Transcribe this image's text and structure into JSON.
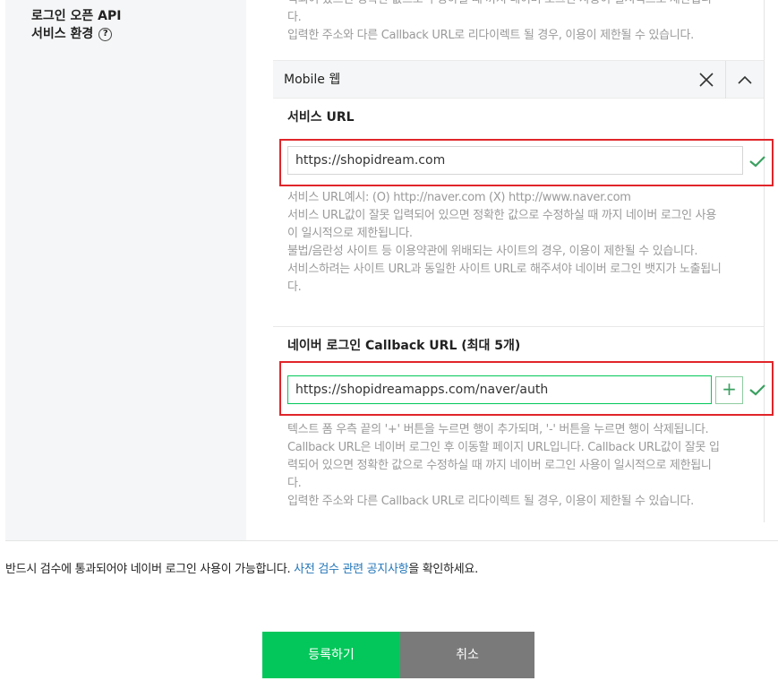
{
  "left": {
    "label_line1": "로그인 오픈 API",
    "label_line2": "서비스 환경",
    "help_glyph": "?"
  },
  "top_help": {
    "line1": "력되어 있으면 정확한 값으로 수정하실 때 까지 네이버 로그인 사용이 일시적으로 제한됩니",
    "line2": "다.",
    "line3": "입력한 주소와 다른 Callback URL로 리다이렉트 될 경우, 이용이 제한될 수 있습니다."
  },
  "section": {
    "title": "Mobile 웹",
    "close_glyph": "✕",
    "collapse_glyph": "︿"
  },
  "service_url": {
    "label": "서비스 URL",
    "value": "https://shopidream.com",
    "help": [
      "서비스 URL예시: (O) http://naver.com (X) http://www.naver.com",
      "서비스 URL값이 잘못 입력되어 있으면 정확한 값으로 수정하실 때 까지 네이버 로그인 사용",
      "이 일시적으로 제한됩니다.",
      "불법/음란성 사이트 등 이용약관에 위배되는 사이트의 경우, 이용이 제한될 수 있습니다.",
      "서비스하려는 사이트 URL과 동일한 사이트 URL로 해주셔야 네이버 로그인 뱃지가 노출됩니",
      "다."
    ]
  },
  "callback_url": {
    "label": "네이버 로그인 Callback URL (최대 5개)",
    "value": "https://shopidreamapps.com/naver/auth",
    "plus_glyph": "+",
    "help": [
      "텍스트 폼 우측 끝의 '+' 버튼을 누르면 행이 추가되며, '-' 버튼을 누르면 행이 삭제됩니다.",
      "Callback URL은 네이버 로그인 후 이동할 페이지 URL입니다. Callback URL값이 잘못 입",
      "력되어 있으면 정확한 값으로 수정하실 때 까지 네이버 로그인 사용이 일시적으로 제한됩니",
      "다.",
      "입력한 주소와 다른 Callback URL로 리다이렉트 될 경우, 이용이 제한될 수 있습니다."
    ]
  },
  "notice": {
    "prefix": "반드시 검수에 통과되어야 네이버 로그인 사용이 가능합니다. ",
    "link": "사전 검수 관련 공지사항",
    "suffix": "을 확인하세요."
  },
  "buttons": {
    "register": "등록하기",
    "cancel": "취소"
  },
  "colors": {
    "brand_green": "#03c75a",
    "highlight_red": "#e0252a",
    "link_blue": "#2276b9"
  }
}
